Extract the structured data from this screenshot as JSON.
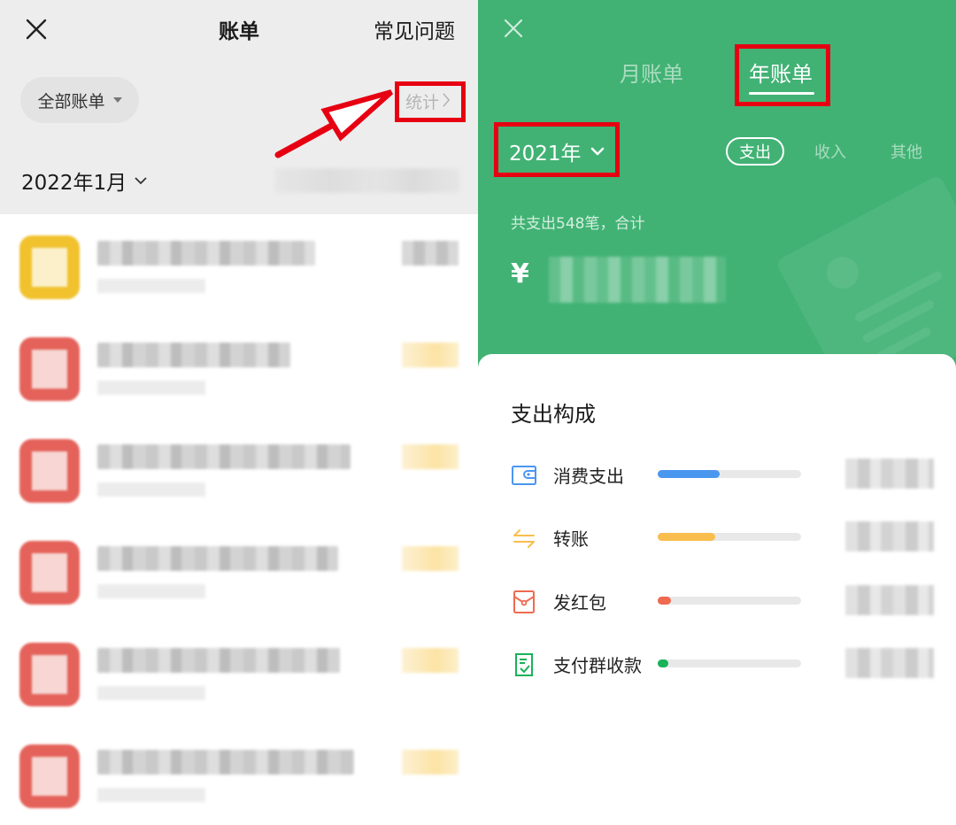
{
  "left_screen": {
    "header": {
      "close_icon": "close-icon",
      "title": "账单",
      "faq_label": "常见问题"
    },
    "filter": {
      "label": "全部账单",
      "icon": "caret-down-icon"
    },
    "stats_link": {
      "label": "统计",
      "icon": "chevron-right-icon",
      "chevron": "›"
    },
    "month_selector": {
      "label": "2022年1月",
      "icon": "chevron-down-icon"
    },
    "month_summary": "[pixelated]",
    "transactions": [
      {
        "icon_color": "yellow",
        "title": "[pixelated]",
        "subtitle": "[pixelated]",
        "amount": "[pixelated]",
        "amount_style": "gray"
      },
      {
        "icon_color": "red",
        "title": "[pixelated]",
        "subtitle": "[pixelated]",
        "amount": "[pixelated]",
        "amount_style": "yellow"
      },
      {
        "icon_color": "red",
        "title": "[pixelated]",
        "subtitle": "[pixelated]",
        "amount": "[pixelated]",
        "amount_style": "yellow"
      },
      {
        "icon_color": "red",
        "title": "[pixelated]",
        "subtitle": "[pixelated]",
        "amount": "[pixelated]",
        "amount_style": "yellow"
      },
      {
        "icon_color": "red",
        "title": "[pixelated]",
        "subtitle": "[pixelated]",
        "amount": "[pixelated]",
        "amount_style": "yellow"
      },
      {
        "icon_color": "red",
        "title": "[pixelated]",
        "subtitle": "[pixelated]",
        "amount": "[pixelated]",
        "amount_style": "yellow"
      }
    ]
  },
  "right_screen": {
    "close_icon": "close-icon",
    "tabs": [
      {
        "label": "月账单",
        "active": false
      },
      {
        "label": "年账单",
        "active": true
      }
    ],
    "year_selector": {
      "label": "2021年",
      "icon": "chevron-down-icon"
    },
    "type_filters": [
      {
        "label": "支出",
        "active": true
      },
      {
        "label": "收入",
        "active": false
      },
      {
        "label": "其他",
        "active": false
      }
    ],
    "summary_text": "共支出548笔，合计",
    "currency_symbol": "¥",
    "total_amount": "[pixelated]",
    "breakdown": {
      "title": "支出构成",
      "items": [
        {
          "label": "消费支出",
          "icon": "wallet-icon",
          "color": "#4A97F0",
          "share": 0.43,
          "amount": "[pixelated]"
        },
        {
          "label": "转账",
          "icon": "transfer-arrows-icon",
          "color": "#F9BE4E",
          "share": 0.4,
          "amount": "[pixelated]"
        },
        {
          "label": "发红包",
          "icon": "red-envelope-icon",
          "color": "#EF6A50",
          "share": 0.09,
          "amount": "[pixelated]"
        },
        {
          "label": "支付群收款",
          "icon": "group-payment-icon",
          "color": "#18B258",
          "share": 0.07,
          "amount": "[pixelated]"
        }
      ]
    }
  },
  "annotations": {
    "color": "#E60012",
    "highlighted": [
      "统计 >",
      "年账单",
      "2021年"
    ]
  },
  "theme": {
    "green": "#41B274",
    "header_gray": "#EDEDED"
  }
}
